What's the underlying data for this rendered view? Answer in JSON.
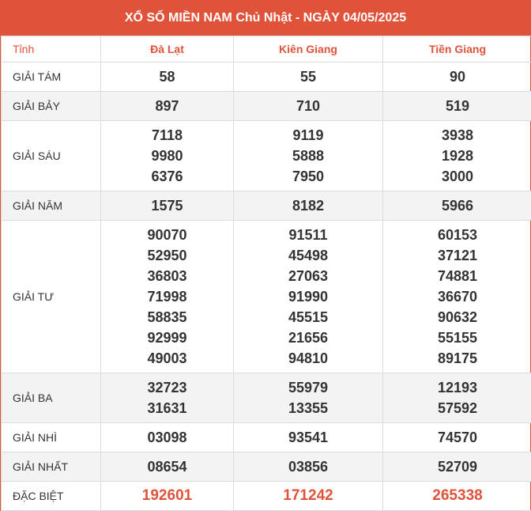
{
  "title": "XỔ SỐ MIỀN NAM Chủ Nhật - NGÀY 04/05/2025",
  "header_label": "Tỉnh",
  "provinces": [
    "Đà Lạt",
    "Kiên Giang",
    "Tiền Giang"
  ],
  "prizes": [
    {
      "label": "GIẢI TÁM",
      "values": [
        [
          "58"
        ],
        [
          "55"
        ],
        [
          "90"
        ]
      ]
    },
    {
      "label": "GIẢI BẢY",
      "values": [
        [
          "897"
        ],
        [
          "710"
        ],
        [
          "519"
        ]
      ]
    },
    {
      "label": "GIẢI SÁU",
      "values": [
        [
          "7118",
          "9980",
          "6376"
        ],
        [
          "9119",
          "5888",
          "7950"
        ],
        [
          "3938",
          "1928",
          "3000"
        ]
      ]
    },
    {
      "label": "GIẢI NĂM",
      "values": [
        [
          "1575"
        ],
        [
          "8182"
        ],
        [
          "5966"
        ]
      ]
    },
    {
      "label": "GIẢI TƯ",
      "values": [
        [
          "90070",
          "52950",
          "36803",
          "71998",
          "58835",
          "92999",
          "49003"
        ],
        [
          "91511",
          "45498",
          "27063",
          "91990",
          "45515",
          "21656",
          "94810"
        ],
        [
          "60153",
          "37121",
          "74881",
          "36670",
          "90632",
          "55155",
          "89175"
        ]
      ]
    },
    {
      "label": "GIẢI BA",
      "values": [
        [
          "32723",
          "31631"
        ],
        [
          "55979",
          "13355"
        ],
        [
          "12193",
          "57592"
        ]
      ]
    },
    {
      "label": "GIẢI NHÌ",
      "values": [
        [
          "03098"
        ],
        [
          "93541"
        ],
        [
          "74570"
        ]
      ]
    },
    {
      "label": "GIẢI NHẤT",
      "values": [
        [
          "08654"
        ],
        [
          "03856"
        ],
        [
          "52709"
        ]
      ]
    },
    {
      "label": "ĐẶC BIỆT",
      "values": [
        [
          "192601"
        ],
        [
          "171242"
        ],
        [
          "265338"
        ]
      ]
    }
  ],
  "colors": {
    "accent": "#e0533b",
    "row_alt": "#f3f3f3",
    "text": "#333333"
  }
}
